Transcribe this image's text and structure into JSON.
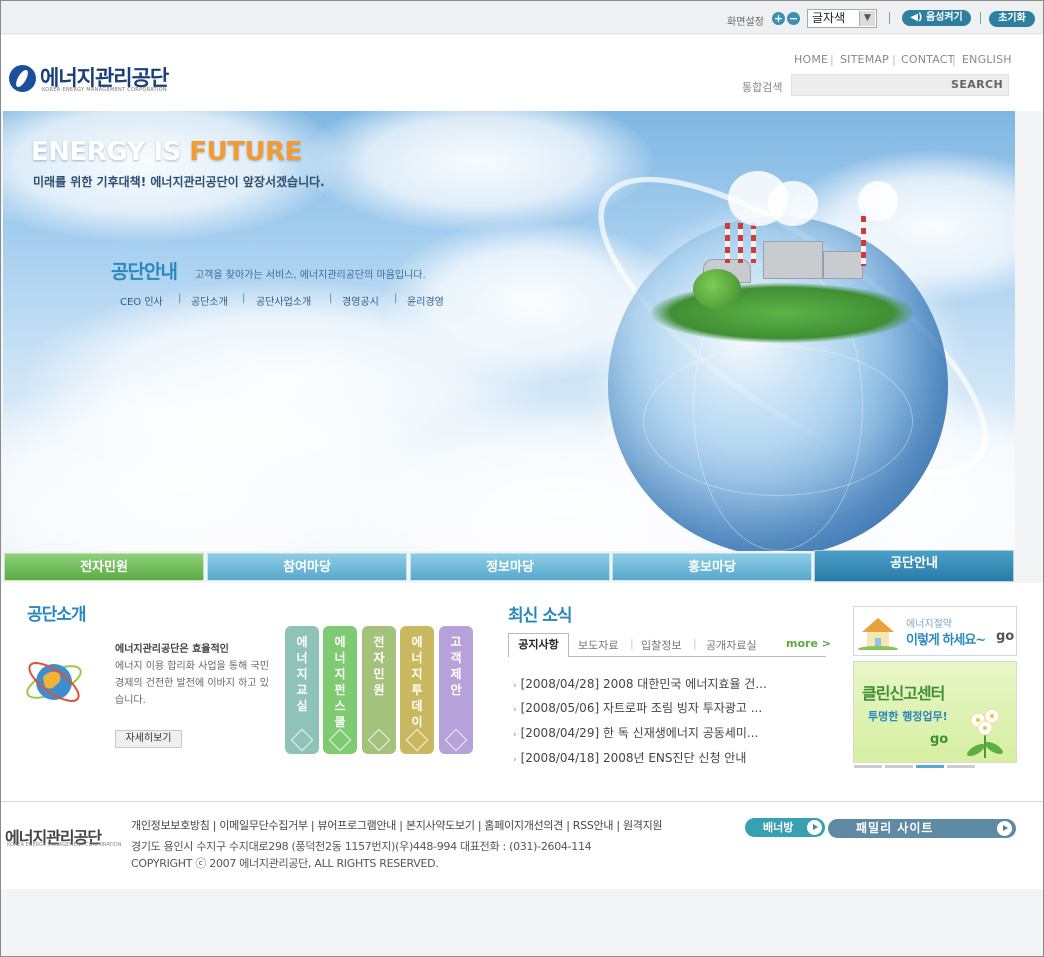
{
  "utility": {
    "screen_setting": "화면설정",
    "zoom_in": "+",
    "zoom_out": "−",
    "font_color_select": "글자색",
    "voice_button": "◀) 음성켜기",
    "reset_button": "초기화"
  },
  "header": {
    "logo_title": "에너지관리공단",
    "logo_subtitle": "KOREA ENERGY MANAGEMENT CORPORATION",
    "nav": [
      "HOME",
      "SITEMAP",
      "CONTACT",
      "ENGLISH"
    ],
    "search_label": "통합검색",
    "search_button": "SEARCH"
  },
  "hero": {
    "title_part1": "ENERGY IS ",
    "title_part2": "FUTURE",
    "subtitle": "미래를 위한 기후대책! 에너지관리공단이 앞장서겠습니다.",
    "section_title": "공단안내",
    "section_desc": "고객을 찾아가는 서비스, 에너지관리공단의 마음입니다.",
    "sub_links": [
      "CEO 인사",
      "공단소개",
      "공단사업소개",
      "경영공시",
      "윤리경영"
    ]
  },
  "main_nav": [
    "전자민원",
    "참여마당",
    "정보마당",
    "홍보마당",
    "공단안내"
  ],
  "intro": {
    "title": "공단소개",
    "text_highlight": "에너지관리공단은 효율적인",
    "text_rest": "에너지 이용 합리화 사업을 통해 국민 경제의 건전한 발전에 이바지 하고 있습니다.",
    "more_button": "자세히보기"
  },
  "quick_buttons": [
    {
      "label": "에너지교실",
      "color": "#8fc3b8"
    },
    {
      "label": "에너지펀스쿨",
      "color": "#7fcb72"
    },
    {
      "label": "전자민원",
      "color": "#a4c27c"
    },
    {
      "label": "에너지투데이",
      "color": "#c9b860"
    },
    {
      "label": "고객제안",
      "color": "#b6a2d8"
    }
  ],
  "news": {
    "title": "최신 소식",
    "tabs": [
      "공지사항",
      "보도자료",
      "입찰정보",
      "공개자료실"
    ],
    "more": "more >",
    "items": [
      "[2008/04/28] 2008 대한민국 에너지효율 건...",
      "[2008/05/06] 자트로파 조림 빙자 투자광고 ...",
      "[2008/04/29] 한 독 신재생에너지 공동세미...",
      "[2008/04/18] 2008년 ENS진단 신청 안내"
    ]
  },
  "banners": {
    "banner1_line1": "에너지절약",
    "banner1_line2": "이렇게 하세요~",
    "banner1_go": "go",
    "banner2_line1": "클린신고센터",
    "banner2_line2": "투명한 행정업무!",
    "banner2_go": "go"
  },
  "footer": {
    "logo": "에너지관리공단",
    "logo_sub": "KOREA ENERGY MANAGEMENT CORPORATION",
    "links": "개인정보보호방침 | 이메일무단수집거부 | 뷰어프로그램안내 | 본지사약도보기 | 홈페이지개선의견 | RSS안내 | 원격지원",
    "address": "경기도 용인시 수지구 수지대로298 (풍덕천2동 1157번지)(우)448-994 대표전화 : (031)-2604-114",
    "copyright": "COPYRIGHT ⓒ 2007 에너지관리공단,  ALL RIGHTS RESERVED.",
    "banner_room": "배너방",
    "family_site": "패밀리 사이트"
  },
  "colors": {
    "accent_blue": "#2a88bf",
    "accent_orange": "#f39a32",
    "nav_green": "#5aaa43",
    "nav_blue": "#58a8cb"
  }
}
